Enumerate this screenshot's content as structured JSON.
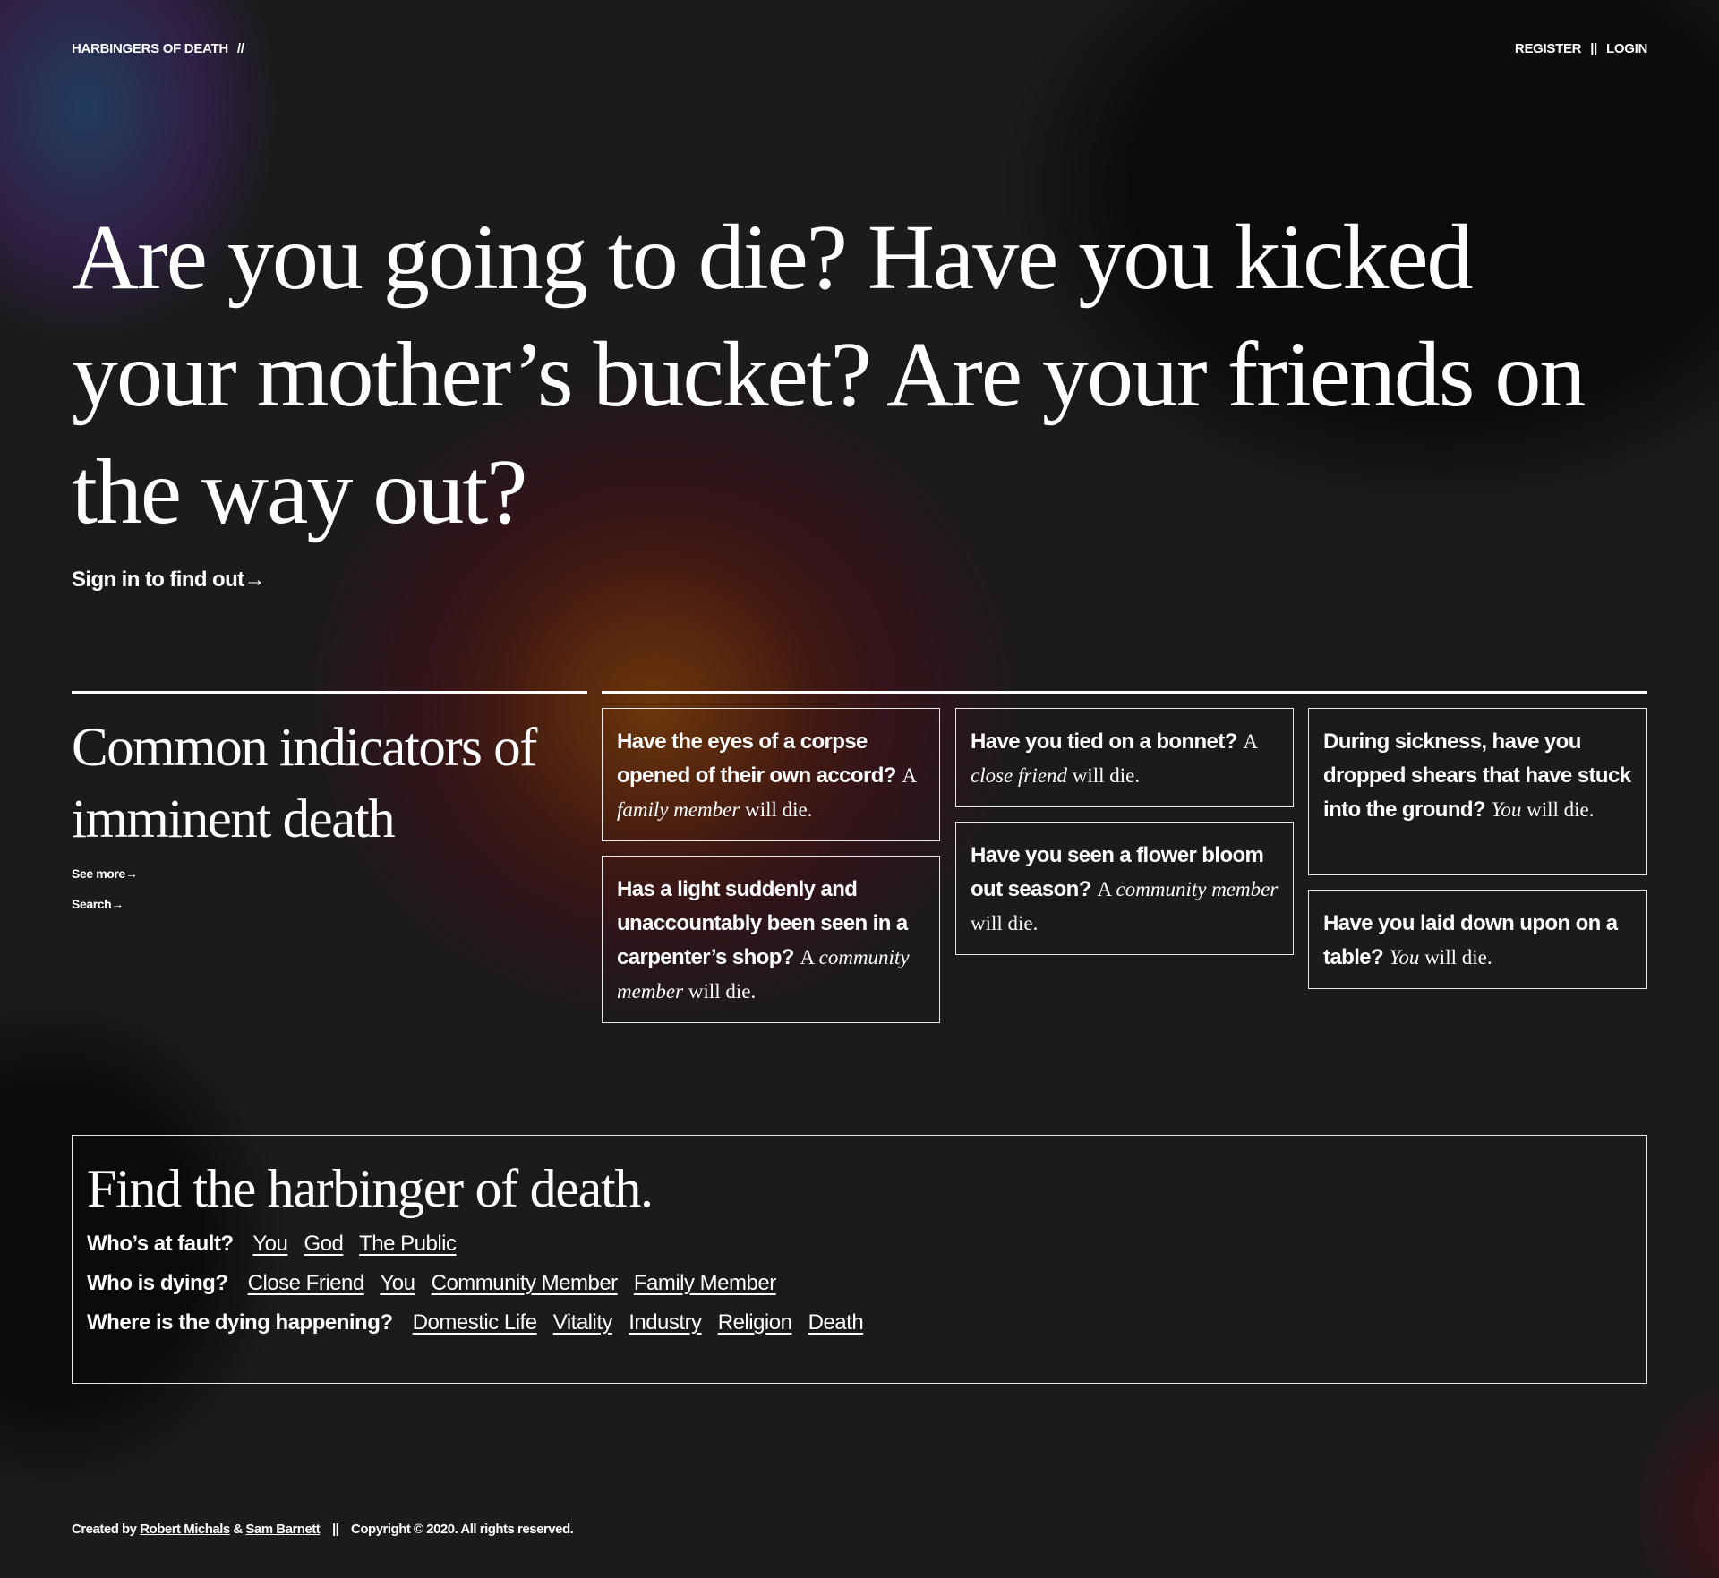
{
  "header": {
    "brand": "HARBINGERS OF DEATH",
    "brand_suffix": "//",
    "register": "REGISTER",
    "divider": "||",
    "login": "LOGIN"
  },
  "hero": {
    "headline": "Are you going to die? Have you kicked your mother’s bucket? Are your friends on the way out?",
    "cta": "Sign in to find out→"
  },
  "indicators": {
    "title": "Common indicators of imminent death",
    "see_more": "See more→",
    "search": "Search→",
    "cards": [
      {
        "question": "Have the eyes of a corpse opened of their own accord?",
        "answer_prefix": "A",
        "who": "family member",
        "answer_suffix": "will die."
      },
      {
        "question": "Has a light suddenly and unaccountably been seen in a carpenter’s shop?",
        "answer_prefix": "A",
        "who": "community member",
        "answer_suffix": "will die."
      },
      {
        "question": "Have you tied on a bonnet?",
        "answer_prefix": "A",
        "who": "close friend",
        "answer_suffix": "will die."
      },
      {
        "question": "Have you seen a flower bloom out season?",
        "answer_prefix": "A",
        "who": "community member",
        "answer_suffix": "will die."
      },
      {
        "question": "During sickness, have you dropped shears that have stuck into the ground?",
        "answer_prefix": "",
        "who": "You",
        "answer_suffix": "will die."
      },
      {
        "question": "Have you laid down upon on a table?",
        "answer_prefix": "",
        "who": "You",
        "answer_suffix": "will die."
      }
    ]
  },
  "finder": {
    "title": "Find the harbinger of death.",
    "fault": {
      "label": "Who’s at fault?",
      "options": [
        "You",
        "God",
        "The Public"
      ]
    },
    "dying": {
      "label": "Who is dying?",
      "options": [
        "Close Friend",
        "You",
        "Community Member",
        "Family Member"
      ]
    },
    "where": {
      "label": "Where is the dying happening?",
      "options": [
        "Domestic Life",
        "Vitality",
        "Industry",
        "Religion",
        "Death"
      ]
    }
  },
  "footer": {
    "created_by": "Created by",
    "author1": "Robert Michals",
    "amp": "&",
    "author2": "Sam Barnett",
    "divider": "||",
    "copyright": "Copyright © 2020. All rights reserved."
  }
}
